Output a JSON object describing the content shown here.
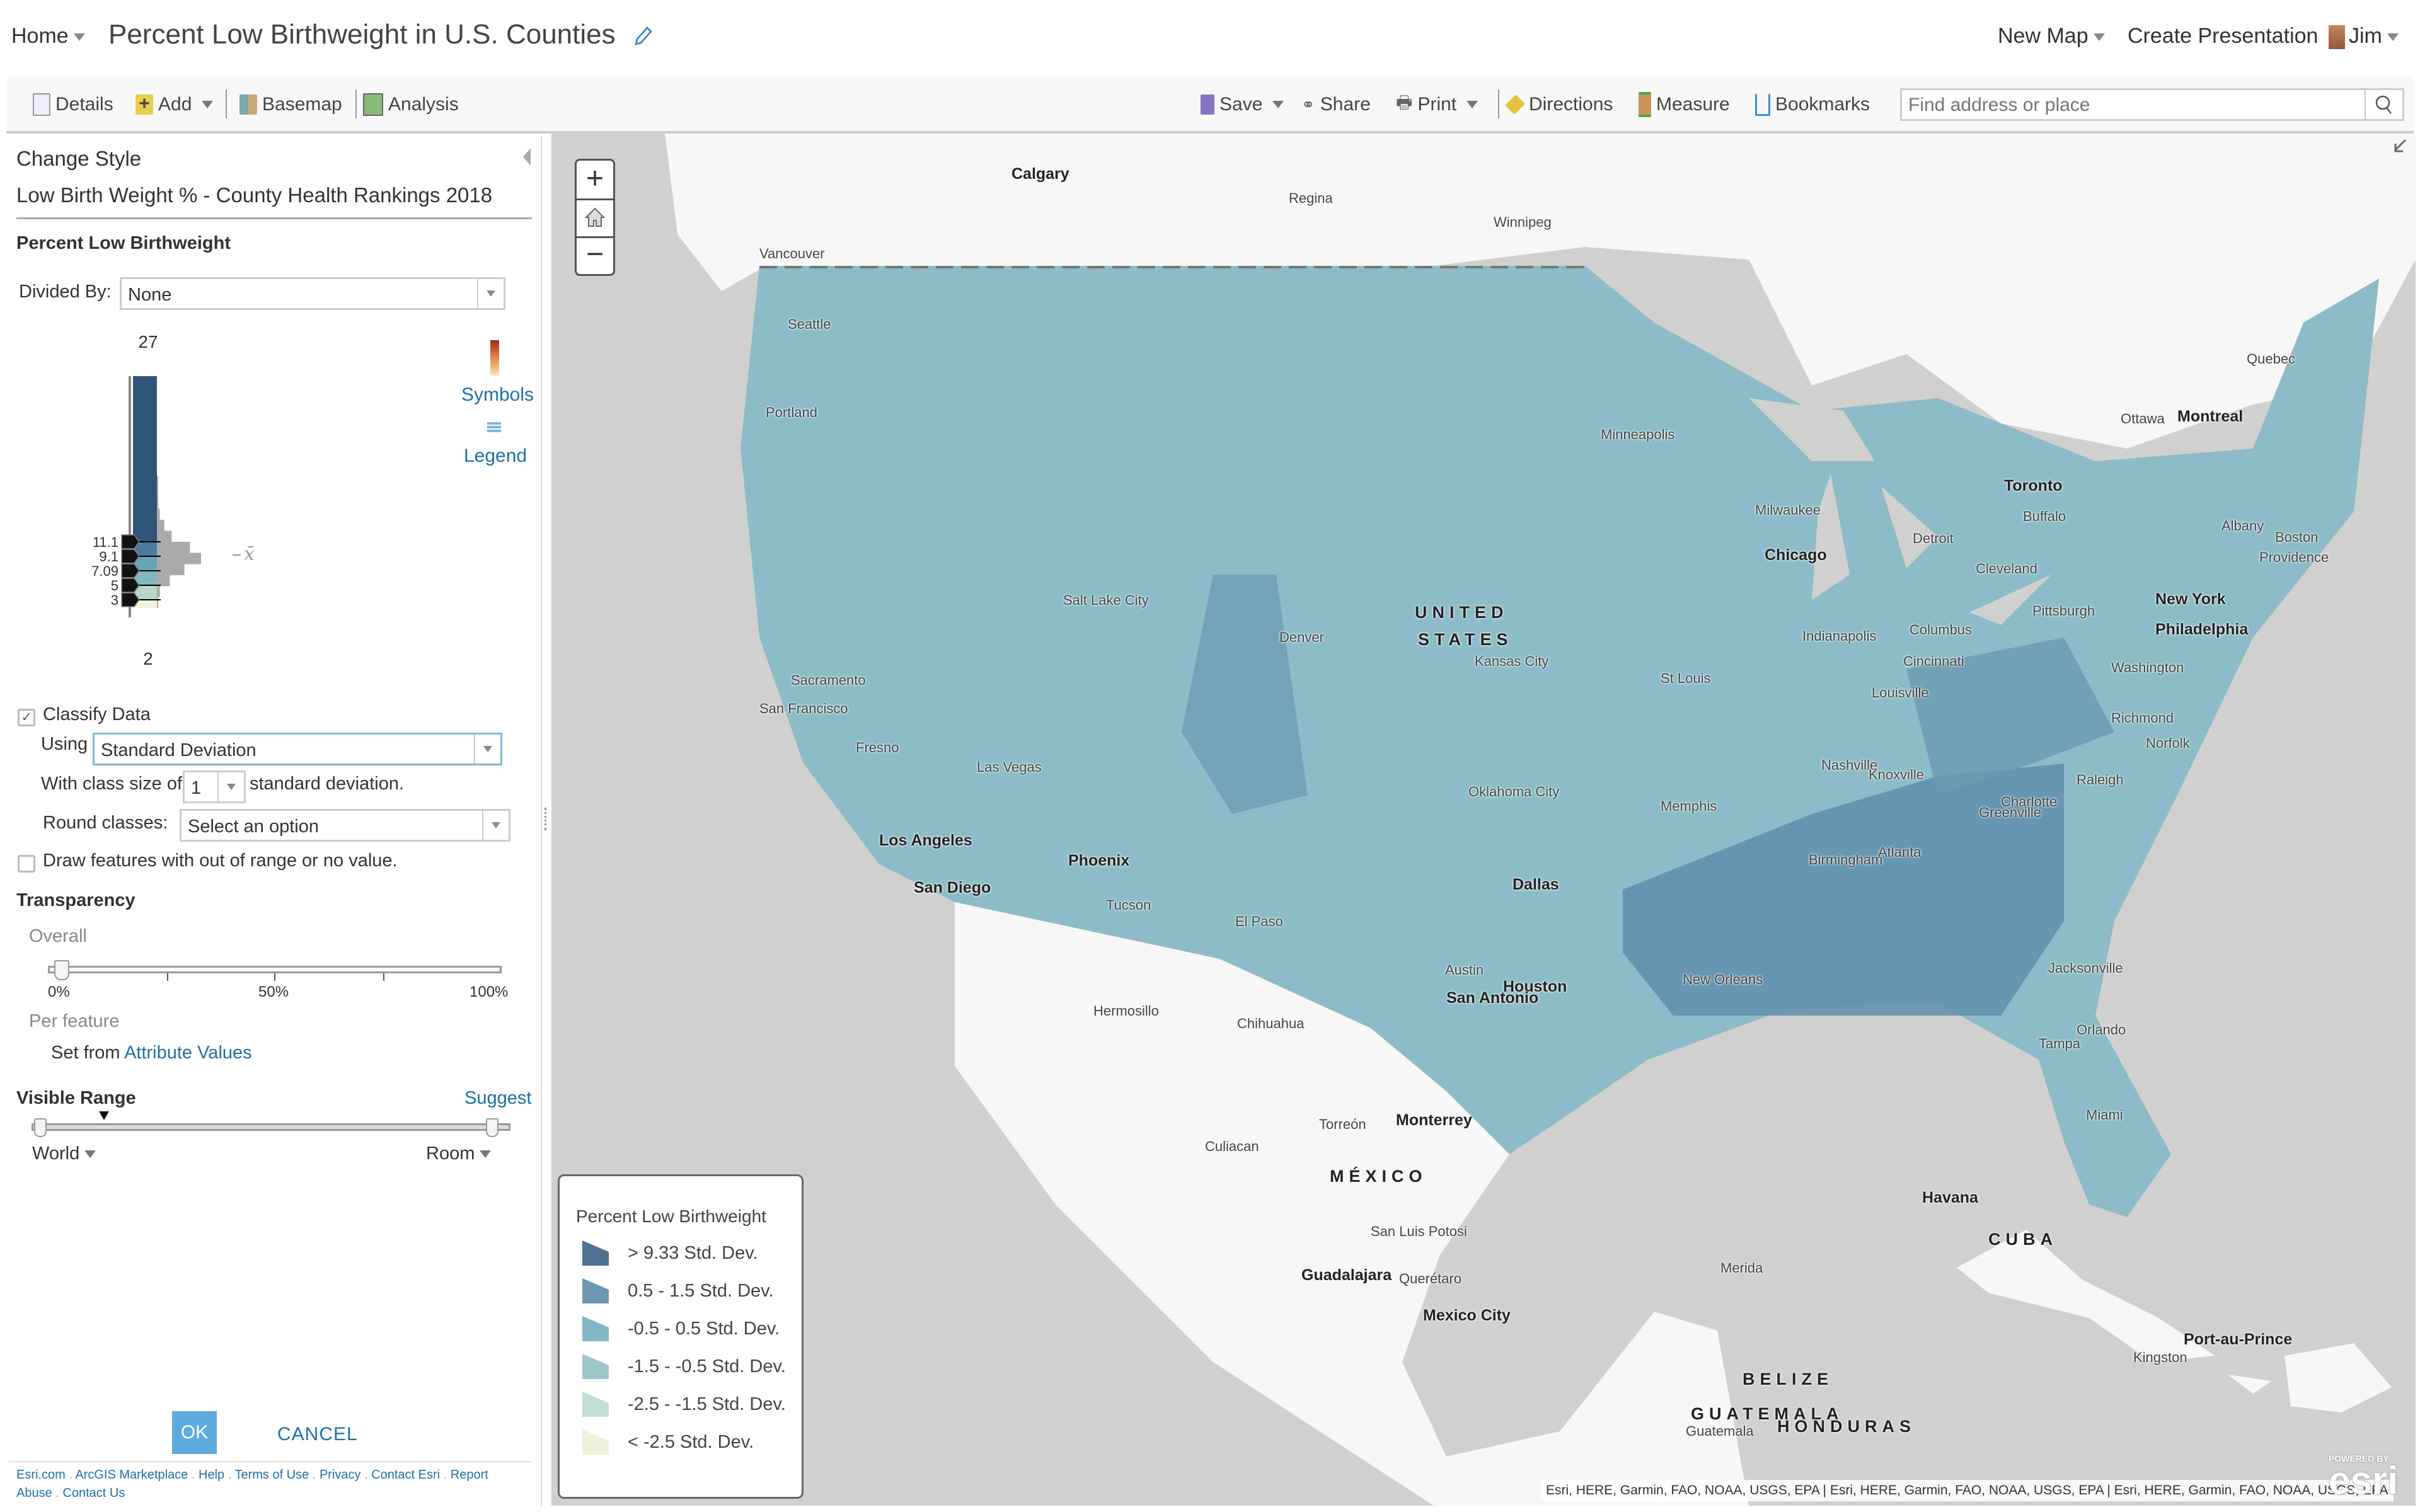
{
  "header": {
    "home_label": "Home",
    "title": "Percent Low Birthweight in U.S. Counties",
    "new_map_label": "New Map",
    "create_presentation_label": "Create Presentation",
    "user_name": "Jim"
  },
  "toolbar": {
    "details": "Details",
    "add": "Add",
    "basemap": "Basemap",
    "analysis": "Analysis",
    "save": "Save",
    "share": "Share",
    "print": "Print",
    "directions": "Directions",
    "measure": "Measure",
    "bookmarks": "Bookmarks",
    "search_placeholder": "Find address or place"
  },
  "panel": {
    "heading": "Change Style",
    "layer_name": "Low Birth Weight % - County Health Rankings 2018",
    "attribute_label": "Percent Low Birthweight",
    "divided_by_label": "Divided By:",
    "divided_by_value": "None",
    "symbols_label": "Symbols",
    "legend_label": "Legend",
    "histogram": {
      "max_label": "27",
      "min_label": "2",
      "mean_symbol": "x̄",
      "breaks": [
        "11.1",
        "9.1",
        "7.09",
        "5",
        "3"
      ],
      "class_colors": [
        "#2e5478",
        "#4a7c9b",
        "#64a6b8",
        "#80b8c2",
        "#b8d6cc",
        "#eef3dc"
      ],
      "distribution_counts": [
        1,
        2,
        4,
        8,
        20,
        40,
        90,
        120,
        75,
        35,
        8,
        3
      ]
    },
    "classify_label": "Classify Data",
    "classify_checked": true,
    "using_label": "Using",
    "using_value": "Standard Deviation",
    "class_size_label": "With class size of",
    "class_size_value": "1",
    "class_size_suffix": "standard deviation.",
    "round_label": "Round classes:",
    "round_value": "Select an option",
    "draw_out_of_range_label": "Draw features with out of range or no value.",
    "draw_out_of_range_checked": false,
    "transparency_label": "Transparency",
    "overall_label": "Overall",
    "transparency_ticks": [
      "0%",
      "50%",
      "100%"
    ],
    "transparency_value_percent": 0,
    "per_feature_label": "Per feature",
    "set_from_label": "Set from",
    "attribute_values_link": "Attribute Values",
    "visible_range_label": "Visible Range",
    "suggest_label": "Suggest",
    "range_min": "World",
    "range_max": "Room",
    "ok_label": "OK",
    "cancel_label": "CANCEL",
    "footer_links": [
      "Esri.com",
      "ArcGIS Marketplace",
      "Help",
      "Terms of Use",
      "Privacy",
      "Contact Esri",
      "Report Abuse",
      "Contact Us"
    ]
  },
  "map": {
    "zoom_in": "+",
    "zoom_out": "−",
    "legend": {
      "title": "Percent Low Birthweight",
      "items": [
        {
          "label": "> 9.33 Std. Dev.",
          "color": "#4f7193"
        },
        {
          "label": "0.5 - 1.5 Std. Dev.",
          "color": "#6b98b0"
        },
        {
          "label": "-0.5 - 0.5 Std. Dev.",
          "color": "#82b6c6"
        },
        {
          "label": "-1.5 - -0.5 Std. Dev.",
          "color": "#9cc6cb"
        },
        {
          "label": "-2.5 - -1.5 Std. Dev.",
          "color": "#c2ddd4"
        },
        {
          "label": "< -2.5 Std. Dev.",
          "color": "#eef3da"
        }
      ]
    },
    "attribution": "Esri, HERE, Garmin, FAO, NOAA, USGS, EPA | Esri, HERE, Garmin, FAO, NOAA, USGS, EPA | Esri, HERE, Garmin, FAO, NOAA, USGS, EPA",
    "esri_powered": "POWERED BY",
    "esri_logo": "esri",
    "labels": {
      "calgary": "Calgary",
      "regina": "Regina",
      "winnipeg": "Winnipeg",
      "vancouver": "Vancouver",
      "seattle": "Seattle",
      "portland": "Portland",
      "quebec": "Quebec",
      "ottawa": "Ottawa",
      "montreal": "Montreal",
      "minneapolis": "Minneapolis",
      "toronto": "Toronto",
      "buffalo": "Buffalo",
      "milwaukee": "Milwaukee",
      "detroit": "Detroit",
      "albany": "Albany",
      "boston": "Boston",
      "providence": "Providence",
      "chicago": "Chicago",
      "cleveland": "Cleveland",
      "new_york": "New York",
      "pittsburgh": "Pittsburgh",
      "philadelphia": "Philadelphia",
      "salt_lake_city": "Salt Lake City",
      "denver": "Denver",
      "us1": "UNITED",
      "us2": "STATES",
      "indianapolis": "Indianapolis",
      "columbus": "Columbus",
      "washington": "Washington",
      "sacramento": "Sacramento",
      "san_francisco": "San Francisco",
      "kansas_city": "Kansas City",
      "st_louis": "St Louis",
      "cincinnati": "Cincinnati",
      "louisville": "Louisville",
      "richmond": "Richmond",
      "fresno": "Fresno",
      "norfolk": "Norfolk",
      "las_vegas": "Las Vegas",
      "nashville": "Nashville",
      "knoxville": "Knoxville",
      "oklahoma_city": "Oklahoma City",
      "memphis": "Memphis",
      "charlotte": "Charlotte",
      "raleigh": "Raleigh",
      "greenville": "Greenville",
      "los_angeles": "Los Angeles",
      "phoenix": "Phoenix",
      "birmingham": "Birmingham",
      "atlanta": "Atlanta",
      "san_diego": "San Diego",
      "dallas": "Dallas",
      "tucson": "Tucson",
      "el_paso": "El Paso",
      "austin": "Austin",
      "houston": "Houston",
      "new_orleans": "New Orleans",
      "jacksonville": "Jacksonville",
      "san_antonio": "San Antonio",
      "hermosillo": "Hermosillo",
      "chihuahua": "Chihuahua",
      "orlando": "Orlando",
      "tampa": "Tampa",
      "miami": "Miami",
      "torreon": "Torreón",
      "monterrey": "Monterrey",
      "culiacan": "Culiacan",
      "mexico": "MÉXICO",
      "havana": "Havana",
      "san_luis_potosi": "San Luis Potosi",
      "cuba": "CUBA",
      "merida": "Merida",
      "guadalajara": "Guadalajara",
      "queretaro": "Querétaro",
      "mexico_city": "Mexico City",
      "port_au_prince": "Port-au-Prince",
      "kingston": "Kingston",
      "belize": "BELIZE",
      "guatemala_country": "GUATEMALA",
      "guatemala_city": "Guatemala",
      "honduras": "HONDURAS"
    }
  }
}
